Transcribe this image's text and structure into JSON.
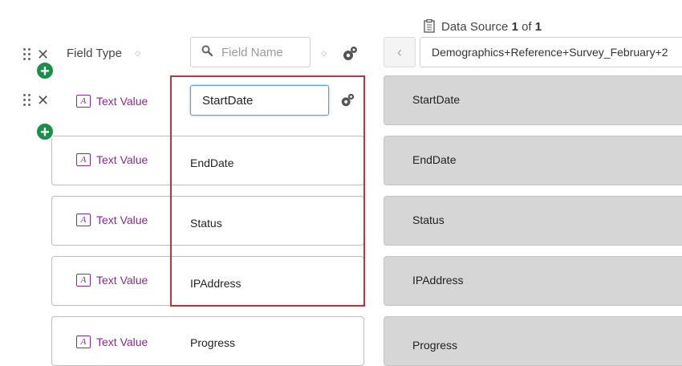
{
  "header": {
    "field_type_label": "Field Type",
    "search_placeholder": "Field Name",
    "data_source_label": "Data Source",
    "data_source_index": "1",
    "data_source_of": "of",
    "data_source_total": "1",
    "data_source_value": "Demographics+Reference+Survey_February+2"
  },
  "rows": [
    {
      "type": "Text Value",
      "field": "StartDate",
      "source": "StartDate"
    },
    {
      "type": "Text Value",
      "field": "EndDate",
      "source": "EndDate"
    },
    {
      "type": "Text Value",
      "field": "Status",
      "source": "Status"
    },
    {
      "type": "Text Value",
      "field": "IPAddress",
      "source": "IPAddress"
    },
    {
      "type": "Text Value",
      "field": "Progress",
      "source": "Progress"
    }
  ],
  "icons": {
    "type_icon_glyph": "A",
    "remove_glyph": "✕",
    "add_glyph": "+",
    "prev_glyph": "‹",
    "sort_glyph_up": "◇"
  },
  "colors": {
    "accent_purple": "#8a2a8e",
    "add_green": "#1a8f4a",
    "highlight_red": "#c0323c",
    "focus_blue": "#5b9bd5"
  }
}
